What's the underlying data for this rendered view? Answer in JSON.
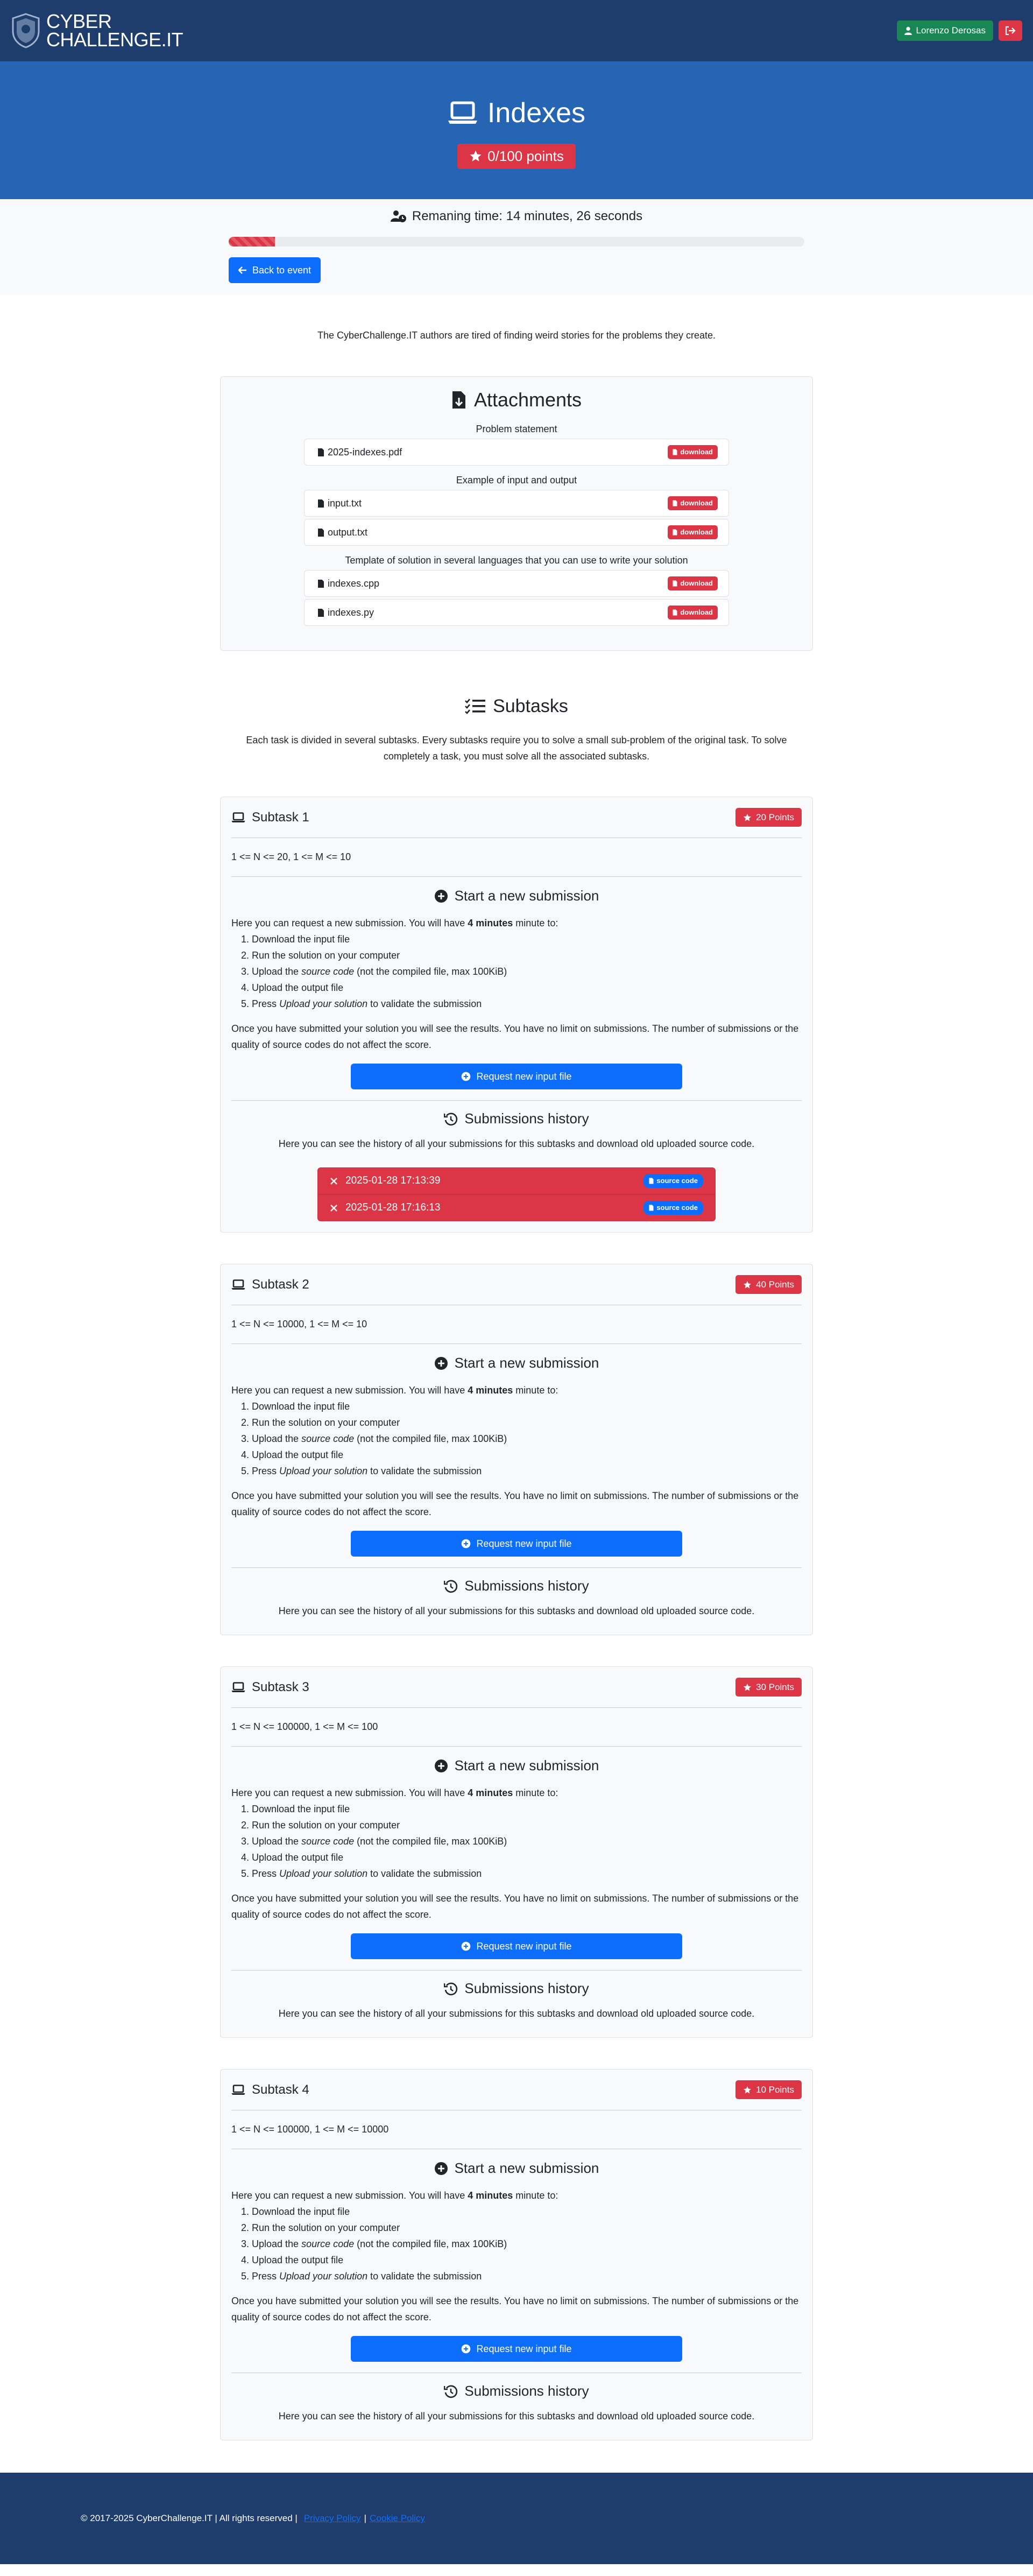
{
  "brand": {
    "line1": "CYBER",
    "line2": "CHALLENGE.IT"
  },
  "user": {
    "name": "Lorenzo Derosas"
  },
  "task": {
    "title": "Indexes",
    "points": "0/100 points"
  },
  "timer": {
    "text": "Remaning time: 14 minutes, 26 seconds",
    "progress": 0.08
  },
  "back_button": "Back to event",
  "description": "The CyberChallenge.IT authors are tired of finding weird stories for the problems they create.",
  "attachments": {
    "title": "Attachments",
    "groups": [
      {
        "label": "Problem statement",
        "files": [
          {
            "name": "2025-indexes.pdf",
            "badge": "download"
          }
        ]
      },
      {
        "label": "Example of input and output",
        "files": [
          {
            "name": "input.txt",
            "badge": "download"
          },
          {
            "name": "output.txt",
            "badge": "download"
          }
        ]
      },
      {
        "label": "Template of solution in several languages that you can use to write your solution",
        "files": [
          {
            "name": "indexes.cpp",
            "badge": "download"
          },
          {
            "name": "indexes.py",
            "badge": "download"
          }
        ]
      }
    ]
  },
  "subtasks_section": {
    "title": "Subtasks",
    "description": "Each task is divided in several subtasks. Every subtasks require you to solve a small sub-problem of the original task. To solve completely a task, you must solve all the associated subtasks."
  },
  "submission_text": {
    "new_title": "Start a new submission",
    "intro_before": "Here you can request a new submission. You will have ",
    "intro_bold": "4 minutes",
    "intro_after": " minute to:",
    "step1": "Download the input file",
    "step2": "Run the solution on your computer",
    "step3_before": "Upload the ",
    "step3_italic": "source code",
    "step3_after": " (not the compiled file, max 100KiB)",
    "step4": "Upload the output file",
    "step5_before": "Press ",
    "step5_italic": "Upload your solution",
    "step5_after": " to validate the submission",
    "after_text": "Once you have submitted your solution you will see the results. You have no limit on submissions. The number of submissions or the quality of source codes do not affect the score.",
    "request_button": "Request new input file",
    "history_title": "Submissions history",
    "history_text": "Here you can see the history of all your submissions for this subtasks and download old uploaded source code."
  },
  "subtasks": [
    {
      "title": "Subtask 1",
      "points": "20 Points",
      "constraint": "1 <= N <= 20, 1 <= M <= 10",
      "history": [
        {
          "time": "2025-01-28 17:13:39",
          "badge": "source code"
        },
        {
          "time": "2025-01-28 17:16:13",
          "badge": "source code"
        }
      ]
    },
    {
      "title": "Subtask 2",
      "points": "40 Points",
      "constraint": "1 <= N <= 10000, 1 <= M <= 10",
      "history": []
    },
    {
      "title": "Subtask 3",
      "points": "30 Points",
      "constraint": "1 <= N <= 100000, 1 <= M <= 100",
      "history": []
    },
    {
      "title": "Subtask 4",
      "points": "10 Points",
      "constraint": "1 <= N <= 100000, 1 <= M <= 10000",
      "history": []
    }
  ],
  "footer": {
    "copyright": "© 2017-2025 CyberChallenge.IT | All rights reserved |",
    "privacy": "Privacy Policy",
    "cookie": "Cookie Policy"
  },
  "colors": {
    "navbar": "#1e3d6c",
    "hero": "#2565b3",
    "danger": "#dc3545",
    "primary": "#0d6efd",
    "success": "#198754"
  },
  "icons": {
    "brand": "shield-logo-icon",
    "user": "user-icon",
    "logout": "logout-icon",
    "task": "laptop-icon",
    "star": "star-icon",
    "timer": "user-clock-icon",
    "back": "arrow-left-icon",
    "attachments": "file-download-icon",
    "file": "file-icon",
    "subtasks": "list-check-icon",
    "new_submission": "plus-circle-icon",
    "history": "history-icon",
    "fail": "x-mark-icon"
  }
}
